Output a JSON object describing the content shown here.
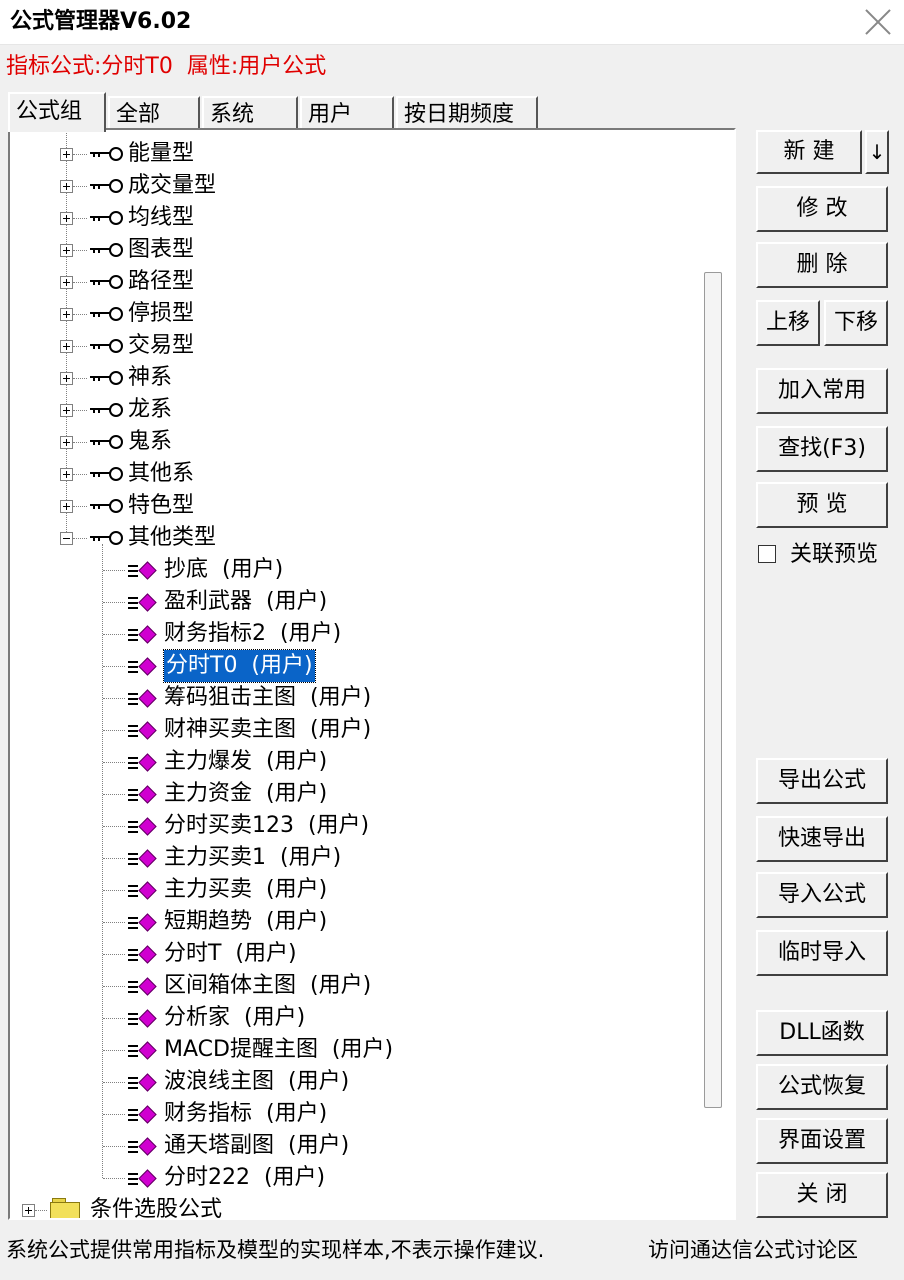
{
  "window": {
    "title": "公式管理器V6.02",
    "close_icon": "close-icon"
  },
  "info": {
    "formula_label": "指标公式:分时T0",
    "attribute_label": "属性:用户公式",
    "color": "#e00000"
  },
  "tabs": [
    {
      "label": "公式组",
      "active": true
    },
    {
      "label": "全部"
    },
    {
      "label": "系统"
    },
    {
      "label": "用户"
    },
    {
      "label": "按日期频度"
    }
  ],
  "tree": {
    "groups": [
      {
        "label": "能量型",
        "expanded": false
      },
      {
        "label": "成交量型",
        "expanded": false
      },
      {
        "label": "均线型",
        "expanded": false
      },
      {
        "label": "图表型",
        "expanded": false
      },
      {
        "label": "路径型",
        "expanded": false
      },
      {
        "label": "停损型",
        "expanded": false
      },
      {
        "label": "交易型",
        "expanded": false
      },
      {
        "label": "神系",
        "expanded": false
      },
      {
        "label": "龙系",
        "expanded": false
      },
      {
        "label": "鬼系",
        "expanded": false
      },
      {
        "label": "其他系",
        "expanded": false
      },
      {
        "label": "特色型",
        "expanded": false
      },
      {
        "label": "其他类型",
        "expanded": true
      }
    ],
    "children": [
      {
        "label": "抄底  (用户)"
      },
      {
        "label": "盈利武器  (用户)"
      },
      {
        "label": "财务指标2  (用户)"
      },
      {
        "label": "分时T0  (用户)",
        "selected": true
      },
      {
        "label": "筹码狙击主图  (用户)"
      },
      {
        "label": "财神买卖主图  (用户)"
      },
      {
        "label": "主力爆发  (用户)"
      },
      {
        "label": "主力资金  (用户)"
      },
      {
        "label": "分时买卖123  (用户)"
      },
      {
        "label": "主力买卖1  (用户)"
      },
      {
        "label": "主力买卖  (用户)"
      },
      {
        "label": "短期趋势  (用户)"
      },
      {
        "label": "分时T  (用户)"
      },
      {
        "label": "区间箱体主图  (用户)"
      },
      {
        "label": "分析家  (用户)"
      },
      {
        "label": "MACD提醒主图  (用户)"
      },
      {
        "label": "波浪线主图  (用户)"
      },
      {
        "label": "财务指标  (用户)"
      },
      {
        "label": "通天塔副图  (用户)"
      },
      {
        "label": "分时222  (用户)"
      }
    ],
    "root_folder": {
      "label": "条件选股公式",
      "expanded": false
    },
    "selection_color": "#0a64c8",
    "leaf_icon_color": "#d000d0"
  },
  "buttons": {
    "new": "新  建",
    "new_arrow": "↓",
    "modify": "修  改",
    "delete": "删  除",
    "move_up": "上移",
    "move_down": "下移",
    "add_common": "加入常用",
    "find": "查找(F3)",
    "preview": "预  览",
    "export": "导出公式",
    "quick_export": "快速导出",
    "import": "导入公式",
    "temp_import": "临时导入",
    "dll": "DLL函数",
    "restore": "公式恢复",
    "ui_settings": "界面设置",
    "close": "关  闭"
  },
  "options": {
    "linked_preview_label": "关联预览",
    "linked_preview_checked": false
  },
  "status": {
    "text": "系统公式提供常用指标及模型的实现样本,不表示操作建议.",
    "link": "访问通达信公式讨论区"
  }
}
